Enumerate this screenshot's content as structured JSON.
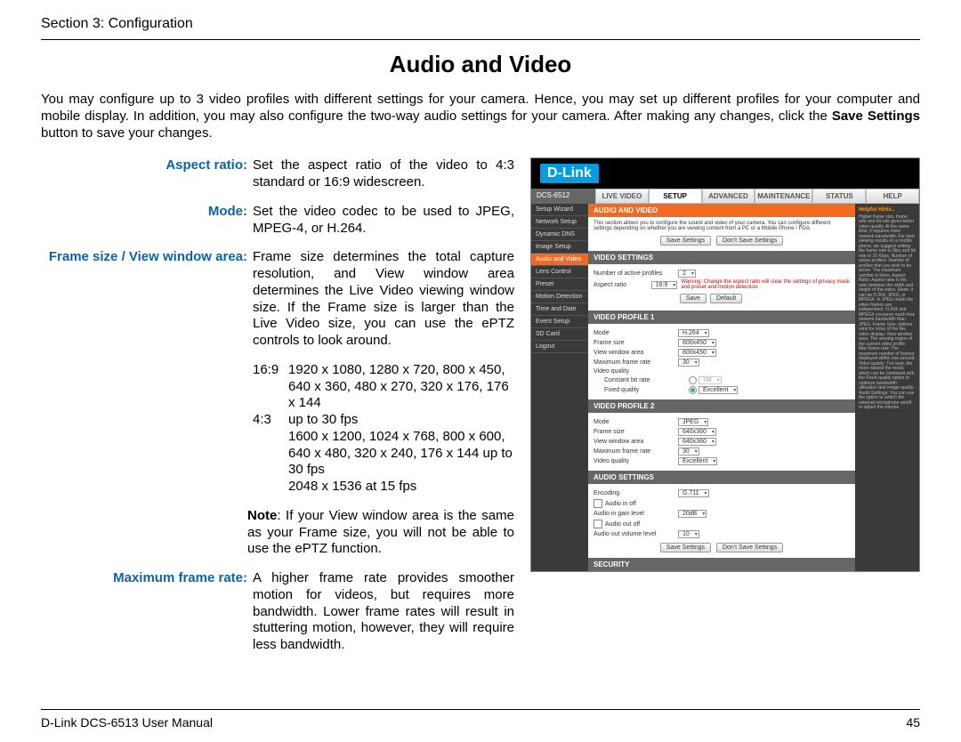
{
  "header": {
    "section": "Section 3: Configuration"
  },
  "title": "Audio and Video",
  "intro": {
    "part1": "You may configure up to 3 video profiles with different settings for your camera. Hence, you may set up different profiles for your computer and mobile display. In addition, you may also configure the two-way audio settings for your camera. After making any changes, click the ",
    "bold": "Save Settings",
    "part2": " button to save your changes."
  },
  "defs": {
    "aspect_label": "Aspect ratio:",
    "aspect_body": "Set the aspect ratio of the video to 4:3 standard or 16:9 widescreen.",
    "mode_label": "Mode:",
    "mode_body": "Set the video codec to be used to JPEG, MPEG-4, or H.264.",
    "frame_label": "Frame size / View window area:",
    "frame_body": "Frame size determines the total capture resolution, and View window area determines the Live Video viewing window size. If the Frame size is larger than the Live Video size, you can use the ePTZ controls to look around.",
    "ratio169": "16:9",
    "ratio169_line1": "1920 x 1080, 1280 x 720, 800 x 450,",
    "ratio169_line2": "640 x 360, 480 x 270, 320 x 176, 176 x 144",
    "ratio169_line3": "up to 30 fps",
    "ratio43": "4:3",
    "ratio43_line1": "1600 x 1200, 1024 x 768, 800 x 600,",
    "ratio43_line2": "640 x 480, 320 x 240, 176 x 144 up to 30 fps",
    "ratio43_line3": "2048 x 1536 at 15 fps",
    "note_bold": "Note",
    "note_body": ": If your View window area is the same as your Frame size, you will not be able to use the ePTZ function.",
    "maxfr_label": "Maximum frame rate:",
    "maxfr_body": "A higher frame rate provides smoother motion for videos, but requires more bandwidth. Lower frame rates will result in stuttering motion, however, they will require less bandwidth."
  },
  "shot": {
    "brand": "D-Link",
    "model": "DCS-6512",
    "tabs": [
      "LIVE VIDEO",
      "SETUP",
      "ADVANCED",
      "MAINTENANCE",
      "STATUS",
      "HELP"
    ],
    "active_tab": 1,
    "side": [
      "Setup Wizard",
      "Network Setup",
      "Dynamic DNS",
      "Image Setup",
      "Audio and Video",
      "Lens Control",
      "Preset",
      "Motion Detection",
      "Time and Date",
      "Event Setup",
      "SD Card",
      "Logout"
    ],
    "side_active": 4,
    "hints_title": "Helpful Hints..",
    "hints_body": "Higher frame size, frame rate and bit rate gives better video quality. At the same time, it requires more network bandwidth. For best viewing results on a mobile phone, we suggest setting the frame rate to 5fps and bit rate to 20 Kbps. Number of active profiles: Number of profiles that you wish to be active. The maximum number is three. Aspect Ratio: Aspect ratio is the ratio between the width and height of the video. Mode: it can be H.264, JPEG, or MPEG4. In JPEG mode the video frames are independent. H.264 and MPEG4 consume much less network bandwidth than JPEG. Frame Size: options exist for sizes of the live video display. View window area: The viewing region of the current video profile. Max frame rate: The maximum number of frames displayed within one second. Video quality: The best, the more natural the result, which can be combined with the Fixed quality option to optimize bandwidth utilization and image quality. Audio Settings: You can use the option to switch the external microphone on/off or adjust the volume.",
    "band_av": "AUDIO AND VIDEO",
    "av_desc": "This section allows you to configure the sound and video of your camera. You can configure different settings depending on whether you are viewing content from a PC or a Mobile Phone / PDA.",
    "save": "Save Settings",
    "dont": "Don't Save Settings",
    "band_vs": "VIDEO SETTINGS",
    "vs_profiles_lab": "Number of active profiles",
    "vs_profiles_val": "2",
    "vs_aspect_lab": "Aspect ratio",
    "vs_aspect_val": "16:9",
    "vs_warn": "Warning: Change the aspect ratio will clear the settings of privacy mask and preset and motion detection.",
    "vs_save": "Save",
    "vs_default": "Default",
    "band_vp1": "VIDEO PROFILE 1",
    "vp1_mode": "H.264",
    "vp1_fs": "800x450",
    "vp1_vw": "800x450",
    "vp1_mfr": "30",
    "lab_mode": "Mode",
    "lab_fs": "Frame size",
    "lab_vw": "View window area",
    "lab_mfr": "Maximum frame rate",
    "lab_vq": "Video quality",
    "lab_cbr": "Constant bit rate",
    "lab_fq": "Fixed quality",
    "vp1_cbr": "1M",
    "vp1_fq": "Excellent",
    "band_vp2": "VIDEO PROFILE 2",
    "vp2_mode": "JPEG",
    "vp2_fs": "640x360",
    "vp2_vw": "640x360",
    "vp2_mfr": "30",
    "vp2_vq": "Excellent",
    "band_as": "AUDIO SETTINGS",
    "as_enc_lab": "Encoding",
    "as_enc_val": "G.711",
    "as_in_lab": "Audio in off",
    "as_gain_lab": "Audio in gain level",
    "as_gain_val": "20dB",
    "as_out_lab": "Audio out off",
    "as_vol_lab": "Audio out volume level",
    "as_vol_val": "10",
    "band_sec": "SECURITY"
  },
  "footer": {
    "left": "D-Link DCS-6513 User Manual",
    "right": "45"
  }
}
